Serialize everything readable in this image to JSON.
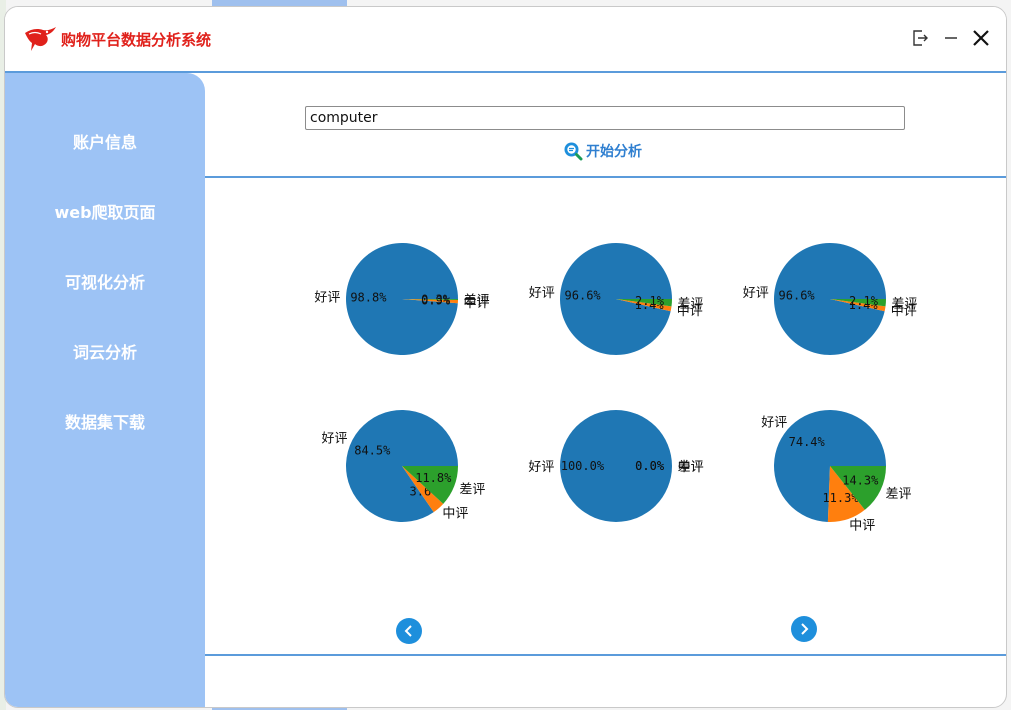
{
  "window": {
    "title": "购物平台数据分析系统"
  },
  "sidebar": {
    "items": [
      {
        "label": "账户信息"
      },
      {
        "label": "web爬取页面"
      },
      {
        "label": "可视化分析"
      },
      {
        "label": "词云分析"
      },
      {
        "label": "数据集下载"
      }
    ]
  },
  "search": {
    "value": "computer",
    "button_label": "开始分析"
  },
  "colors": {
    "good": "#1f77b4",
    "medium": "#ff7f0e",
    "bad": "#2ca02c",
    "accent": "#5b9bdb",
    "sidebar": "#9dc3f5"
  },
  "chart_data": [
    {
      "type": "pie",
      "labels": [
        "好评",
        "中评",
        "差评"
      ],
      "values": [
        98.8,
        0.9,
        0.3
      ],
      "autopct": [
        "98.8%",
        "0.9%",
        "0.3%"
      ]
    },
    {
      "type": "pie",
      "labels": [
        "好评",
        "中评",
        "差评"
      ],
      "values": [
        96.6,
        1.4,
        2.1
      ],
      "autopct": [
        "96.6%",
        "1.4%",
        "2.1%"
      ]
    },
    {
      "type": "pie",
      "labels": [
        "好评",
        "中评",
        "差评"
      ],
      "values": [
        96.6,
        1.4,
        2.1
      ],
      "autopct": [
        "96.6%",
        "1.4%",
        "2.1%"
      ]
    },
    {
      "type": "pie",
      "labels": [
        "好评",
        "中评",
        "差评"
      ],
      "values": [
        84.5,
        3.6,
        11.8
      ],
      "autopct": [
        "84.5%",
        "3.6%",
        "11.8%"
      ]
    },
    {
      "type": "pie",
      "labels": [
        "好评",
        "中评",
        "差评"
      ],
      "values": [
        100.0,
        0.0,
        0.0
      ],
      "autopct": [
        "100.0%",
        "0.0%",
        "0.0%"
      ]
    },
    {
      "type": "pie",
      "labels": [
        "好评",
        "中评",
        "差评"
      ],
      "values": [
        74.4,
        11.3,
        14.3
      ],
      "autopct": [
        "74.4%",
        "11.3%",
        "14.3%"
      ]
    }
  ]
}
